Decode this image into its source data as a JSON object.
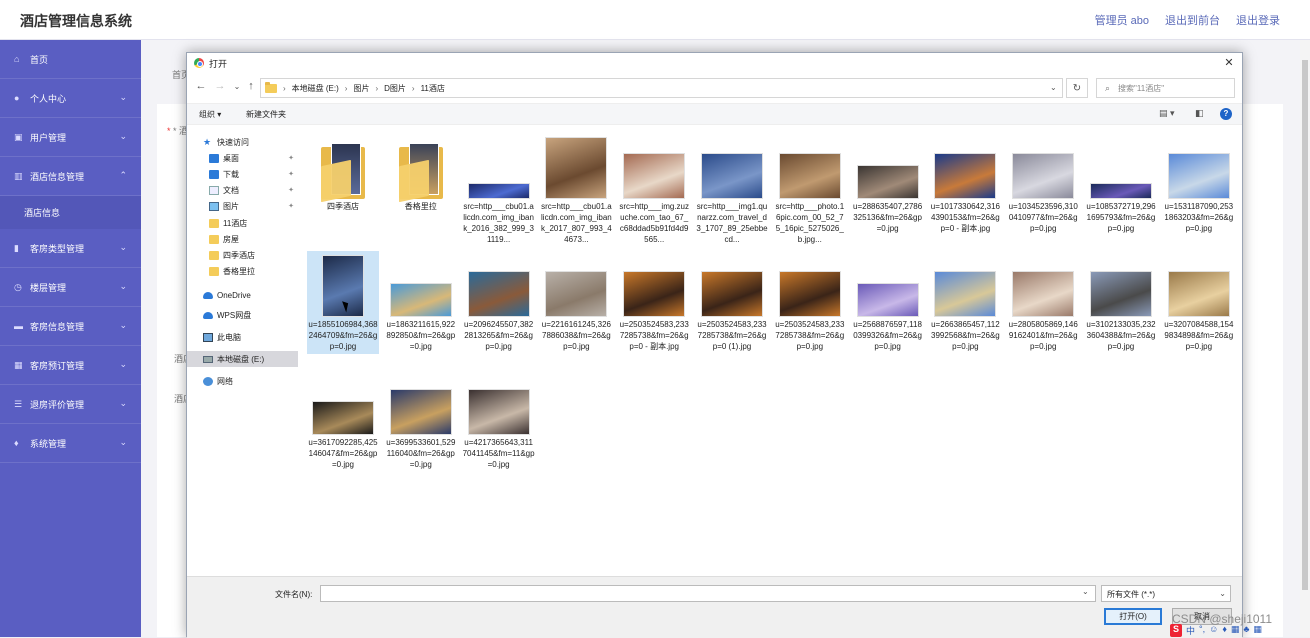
{
  "app": {
    "title": "酒店管理信息系统",
    "top_links": [
      "管理员 abo",
      "退出到前台",
      "退出登录"
    ]
  },
  "sidebar": {
    "items": [
      {
        "label": "首页",
        "icon": "home-icon",
        "expandable": false
      },
      {
        "label": "个人中心",
        "icon": "user-icon",
        "expandable": true
      },
      {
        "label": "用户管理",
        "icon": "users-icon",
        "expandable": true
      },
      {
        "label": "酒店信息管理",
        "icon": "building-icon",
        "expandable": true,
        "expanded": true
      },
      {
        "label": "酒店信息",
        "sub": true
      },
      {
        "label": "客房类型管理",
        "icon": "chart-icon",
        "expandable": true
      },
      {
        "label": "楼层管理",
        "icon": "clock-icon",
        "expandable": true
      },
      {
        "label": "客房信息管理",
        "icon": "bed-icon",
        "expandable": true
      },
      {
        "label": "客房预订管理",
        "icon": "calendar-icon",
        "expandable": true
      },
      {
        "label": "退房评价管理",
        "icon": "list-icon",
        "expandable": true
      },
      {
        "label": "系统管理",
        "icon": "mic-icon",
        "expandable": true
      }
    ]
  },
  "background": {
    "fragments": [
      "首页",
      "* 酒店",
      "酒店",
      "酒店"
    ]
  },
  "dialog": {
    "title": "打开",
    "close": "✕",
    "breadcrumbs": [
      "本地磁盘 (E:)",
      "图片",
      "D图片",
      "11酒店"
    ],
    "search_placeholder": "搜索\"11酒店\"",
    "toolbar": {
      "organize": "组织 ▾",
      "new_folder": "新建文件夹"
    },
    "nav_pane": [
      {
        "label": "快速访问",
        "icon": "star",
        "indent": 0
      },
      {
        "label": "桌面",
        "icon": "blue",
        "indent": 1,
        "pinned": true
      },
      {
        "label": "下载",
        "icon": "blue",
        "indent": 1,
        "pinned": true
      },
      {
        "label": "文档",
        "icon": "docs",
        "indent": 1,
        "pinned": true
      },
      {
        "label": "图片",
        "icon": "pics",
        "indent": 1,
        "pinned": true
      },
      {
        "label": "11酒店",
        "icon": "folder",
        "indent": 1
      },
      {
        "label": "房屋",
        "icon": "folder",
        "indent": 1
      },
      {
        "label": "四季酒店",
        "icon": "folder",
        "indent": 1
      },
      {
        "label": "香格里拉",
        "icon": "folder",
        "indent": 1
      },
      {
        "label": "OneDrive",
        "icon": "cloud",
        "indent": 0
      },
      {
        "label": "WPS网盘",
        "icon": "cloud",
        "indent": 0
      },
      {
        "label": "此电脑",
        "icon": "pc",
        "indent": 0
      },
      {
        "label": "本地磁盘 (E:)",
        "icon": "drive",
        "indent": 0,
        "selected": true
      },
      {
        "label": "网络",
        "icon": "net",
        "indent": 0
      }
    ],
    "files": [
      {
        "name": "四季酒店",
        "type": "folder",
        "c1": "#2c3550",
        "c2": "#5b6b9a"
      },
      {
        "name": "香格里拉",
        "type": "folder",
        "c1": "#3a4258",
        "c2": "#c9a060"
      },
      {
        "name": "src=http___cbu01.alicdn.com_img_ibank_2016_382_999_31119...",
        "c1": "#1c2a6a",
        "c2": "#4d6bd1",
        "thumb": "wide"
      },
      {
        "name": "src=http___cbu01.alicdn.com_img_ibank_2017_807_993_44673...",
        "c1": "#c8a47e",
        "c2": "#6b4a30",
        "thumb": "tall"
      },
      {
        "name": "src=http___img.zuzuche.com_tao_67_c68ddad5b91fd4d9565...",
        "c1": "#a46a52",
        "c2": "#e8d8c8",
        "thumb": "mid"
      },
      {
        "name": "src=http___img1.qunarzz.com_travel_d3_1707_89_25ebbecd...",
        "c1": "#2b4b8a",
        "c2": "#7a96c8",
        "thumb": "mid"
      },
      {
        "name": "src=http___photo.16pic.com_00_52_75_16pic_5275026_b.jpg...",
        "c1": "#6a4a30",
        "c2": "#c09a70",
        "thumb": "mid"
      },
      {
        "name": "u=288635407,2786325136&fm=26&gp=0.jpg",
        "c1": "#3a3532",
        "c2": "#a08a78",
        "thumb": "mid2"
      },
      {
        "name": "u=1017330642,3164390153&fm=26&gp=0 - 副本.jpg",
        "c1": "#1a3a8a",
        "c2": "#c87a3a",
        "thumb": "mid"
      },
      {
        "name": "u=1034523596,3100410977&fm=26&gp=0.jpg",
        "c1": "#8a8a9a",
        "c2": "#d8d8e0",
        "thumb": "mid"
      },
      {
        "name": "u=1085372719,2961695793&fm=26&gp=0.jpg",
        "c1": "#1a2a5a",
        "c2": "#6a5ab8",
        "thumb": "wide"
      },
      {
        "name": "u=1531187090,2531863203&fm=26&gp=0.jpg",
        "c1": "#5a8ad8",
        "c2": "#c8d8e8",
        "thumb": "mid"
      },
      {
        "name": "u=1855106984,3682464709&fm=26&gp=0.jpg",
        "c1": "#1c2a48",
        "c2": "#5a7ab0",
        "thumb": "tall2",
        "selected": true
      },
      {
        "name": "u=1863211615,922892850&fm=26&gp=0.jpg",
        "c1": "#4a9ad8",
        "c2": "#d8b878",
        "thumb": "mid2"
      },
      {
        "name": "u=2096245507,3822813265&fm=26&gp=0.jpg",
        "c1": "#2a6a9a",
        "c2": "#8a5a3a",
        "thumb": "mid"
      },
      {
        "name": "u=2216161245,3267886038&fm=26&gp=0.jpg",
        "c1": "#b8b0a8",
        "c2": "#8a7a6a",
        "thumb": "mid"
      },
      {
        "name": "u=2503524583,2337285738&fm=26&gp=0 - 副本.jpg",
        "c1": "#c8782a",
        "c2": "#3a2418",
        "thumb": "mid"
      },
      {
        "name": "u=2503524583,2337285738&fm=26&gp=0 (1).jpg",
        "c1": "#c8782a",
        "c2": "#3a2418",
        "thumb": "mid"
      },
      {
        "name": "u=2503524583,2337285738&fm=26&gp=0.jpg",
        "c1": "#c8782a",
        "c2": "#3a2418",
        "thumb": "mid"
      },
      {
        "name": "u=2568876597,1180399326&fm=26&gp=0.jpg",
        "c1": "#6a5ab8",
        "c2": "#c8b8e8",
        "thumb": "mid2"
      },
      {
        "name": "u=2663865457,1123992568&fm=26&gp=0.jpg",
        "c1": "#5a8ad8",
        "c2": "#d8c898",
        "thumb": "mid"
      },
      {
        "name": "u=2805805869,1469162401&fm=26&gp=0.jpg",
        "c1": "#9a7a6a",
        "c2": "#e8d8c8",
        "thumb": "mid"
      },
      {
        "name": "u=3102133035,2323604388&fm=26&gp=0.jpg",
        "c1": "#8a9ab8",
        "c2": "#4a4a4a",
        "thumb": "mid"
      },
      {
        "name": "u=3207084588,1549834898&fm=26&gp=0.jpg",
        "c1": "#9a7a4a",
        "c2": "#e8d0a0",
        "thumb": "mid"
      },
      {
        "name": "u=3617092285,425146047&fm=26&gp=0.jpg",
        "c1": "#1a1a1a",
        "c2": "#a88a5a",
        "thumb": "mid2"
      },
      {
        "name": "u=3699533601,529116040&fm=26&gp=0.jpg",
        "c1": "#2a3a6a",
        "c2": "#c8a060",
        "thumb": "mid"
      },
      {
        "name": "u=4217365643,3117041145&fm=11&gp=0.jpg",
        "c1": "#3a3030",
        "c2": "#c8b8a8",
        "thumb": "mid"
      }
    ],
    "filename_label": "文件名(N):",
    "filename_value": "",
    "file_type": "所有文件 (*.*)",
    "open_label": "打开(O)",
    "cancel_label": "取消"
  },
  "watermark": "CSDN @sheji1011",
  "ime": [
    "S",
    "中",
    "°,",
    "☺",
    "♦",
    "▦",
    "♣",
    "▦"
  ]
}
